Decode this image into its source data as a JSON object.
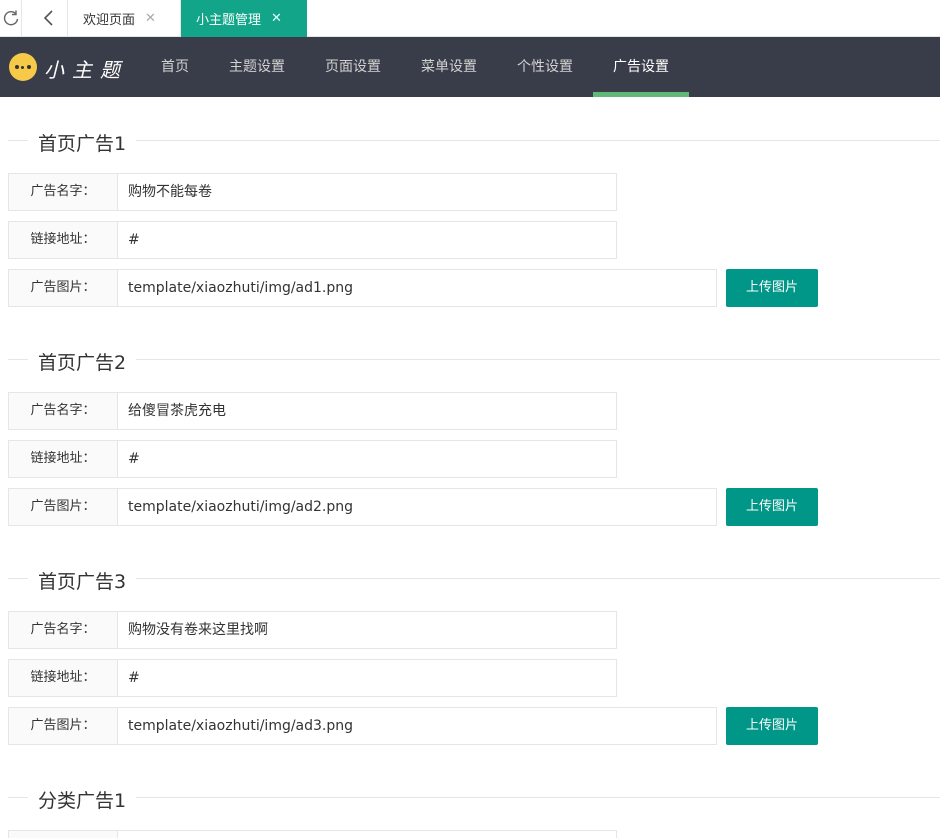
{
  "tabbar": {
    "tabs": [
      {
        "label": "欢迎页面",
        "active": false
      },
      {
        "label": "小主题管理",
        "active": true
      }
    ],
    "close_glyph": "✕"
  },
  "navbar": {
    "logo_text": "小主题",
    "items": [
      {
        "label": "首页"
      },
      {
        "label": "主题设置"
      },
      {
        "label": "页面设置"
      },
      {
        "label": "菜单设置"
      },
      {
        "label": "个性设置"
      },
      {
        "label": "广告设置",
        "active": true
      }
    ]
  },
  "labels": {
    "name": "广告名字：",
    "link": "链接地址：",
    "image": "广告图片：",
    "upload": "上传图片"
  },
  "sections": [
    {
      "title": "首页广告1",
      "name": "购物不能每卷",
      "link": "#",
      "image": "template/xiaozhuti/img/ad1.png"
    },
    {
      "title": "首页广告2",
      "name": "给傻冒茶虎充电",
      "link": "#",
      "image": "template/xiaozhuti/img/ad2.png"
    },
    {
      "title": "首页广告3",
      "name": "购物没有卷来这里找啊",
      "link": "#",
      "image": "template/xiaozhuti/img/ad3.png"
    },
    {
      "title": "分类广告1"
    }
  ],
  "colors": {
    "tab_active": "#12a589",
    "navbar_bg": "#393d49",
    "nav_active_underline": "#5fb878",
    "upload_button": "#009688"
  }
}
